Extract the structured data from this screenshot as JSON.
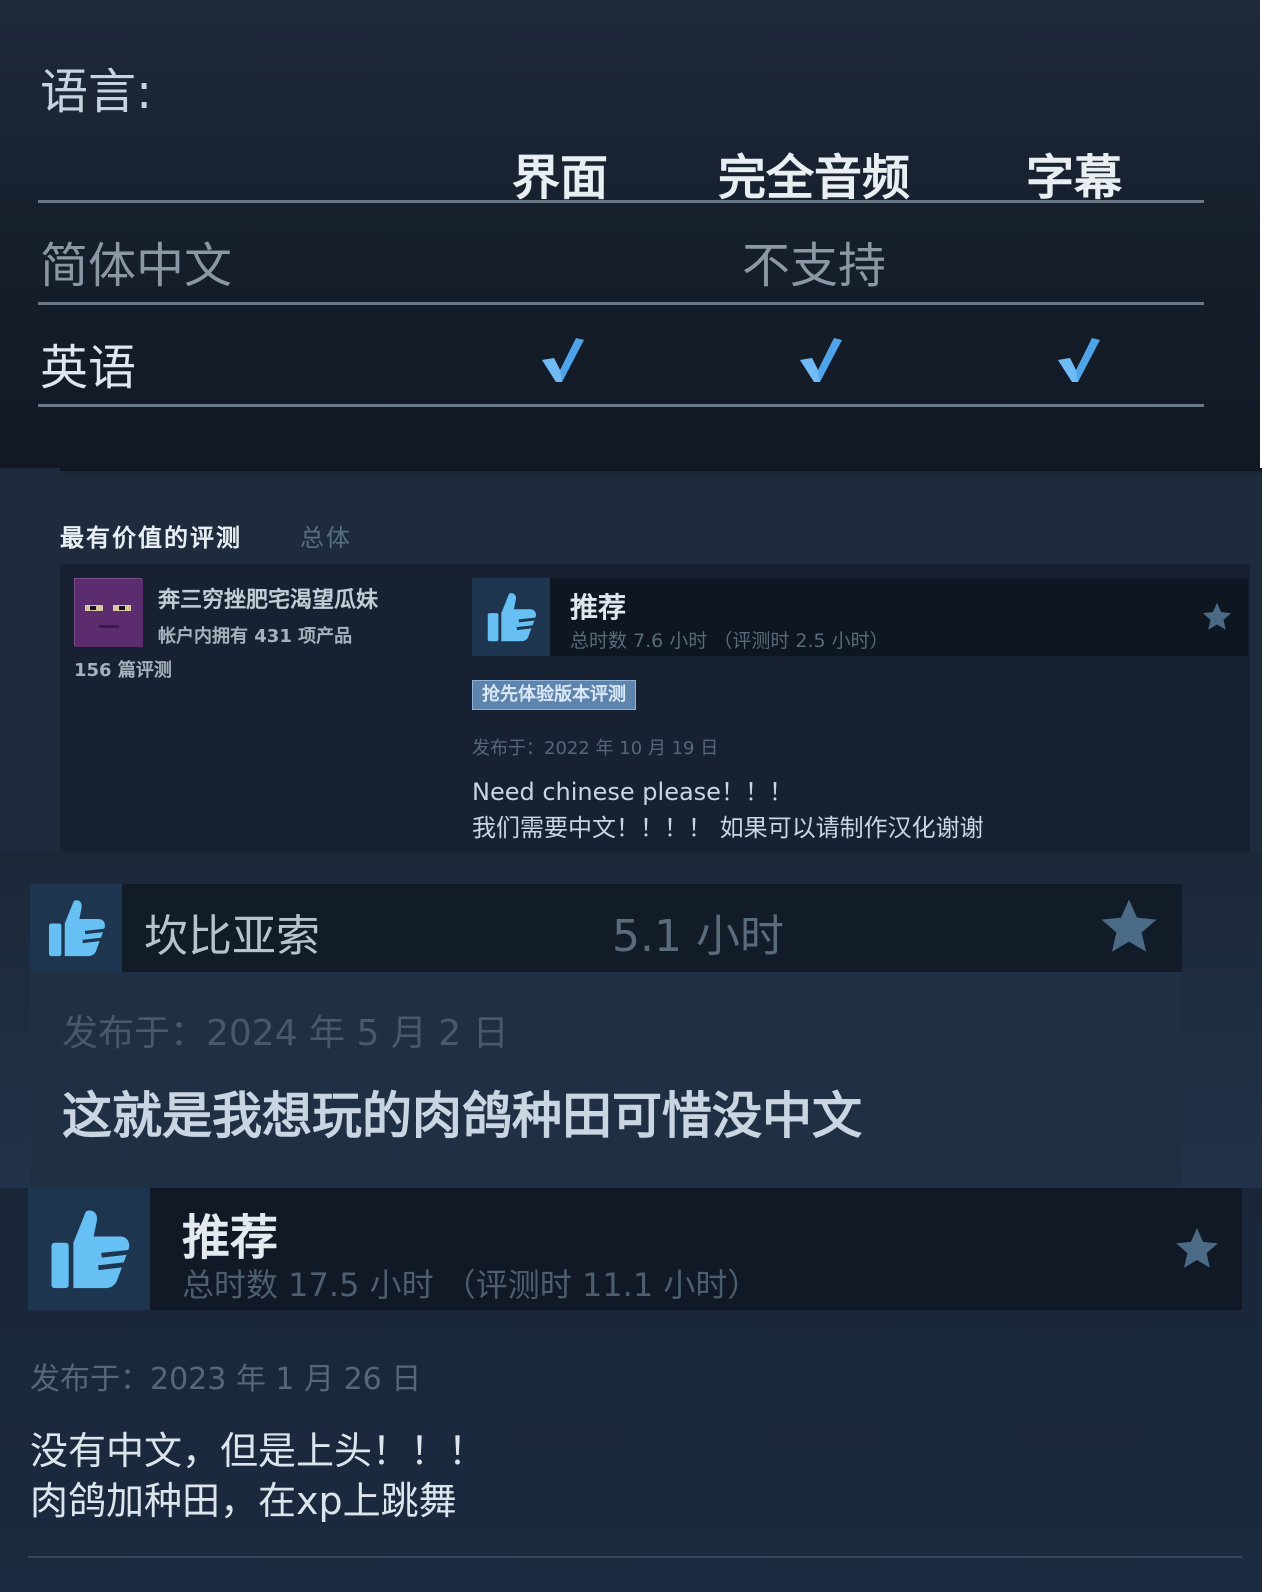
{
  "languages": {
    "title": "语言:",
    "columns": [
      "界面",
      "完全音频",
      "字幕"
    ],
    "rows": [
      {
        "name": "简体中文",
        "status": "不支持"
      },
      {
        "name": "英语",
        "interface": true,
        "full_audio": true,
        "subtitles": true
      }
    ]
  },
  "helpful_reviews": {
    "heading": "最有价值的评测",
    "scope": "总体",
    "review": {
      "author": "奔三穷挫肥宅渴望瓜妹",
      "products_owned": "帐户内拥有 431 项产品",
      "review_count": "156 篇评测",
      "verdict": "推荐",
      "hours": "总时数 7.6 小时 （评测时 2.5 小时）",
      "badge": "抢先体验版本评测",
      "posted": "发布于：2022 年 10 月 19 日",
      "body_lines": [
        "Need chinese please！！！",
        "我们需要中文！！！！ 如果可以请制作汉化谢谢"
      ]
    }
  },
  "review2": {
    "author": "坎比亚索",
    "hours": "5.1 小时",
    "posted": "发布于：2024 年 5 月 2 日",
    "body": "这就是我想玩的肉鸽种田可惜没中文"
  },
  "review3": {
    "verdict": "推荐",
    "hours": "总时数 17.5 小时 （评测时 11.1 小时）",
    "posted": "发布于：2023 年 1 月 26 日",
    "body_lines": [
      "没有中文，但是上头！！！",
      "肉鸽加种田，在xp上跳舞"
    ]
  },
  "icons": {
    "thumb": "thumbs-up-icon",
    "check": "checkmark-icon",
    "star": "star-icon",
    "avatar": "avatar"
  },
  "colors": {
    "accent_blue": "#66c0f4",
    "check_blue": "#4fa3e8",
    "panel_dark": "#172131"
  }
}
